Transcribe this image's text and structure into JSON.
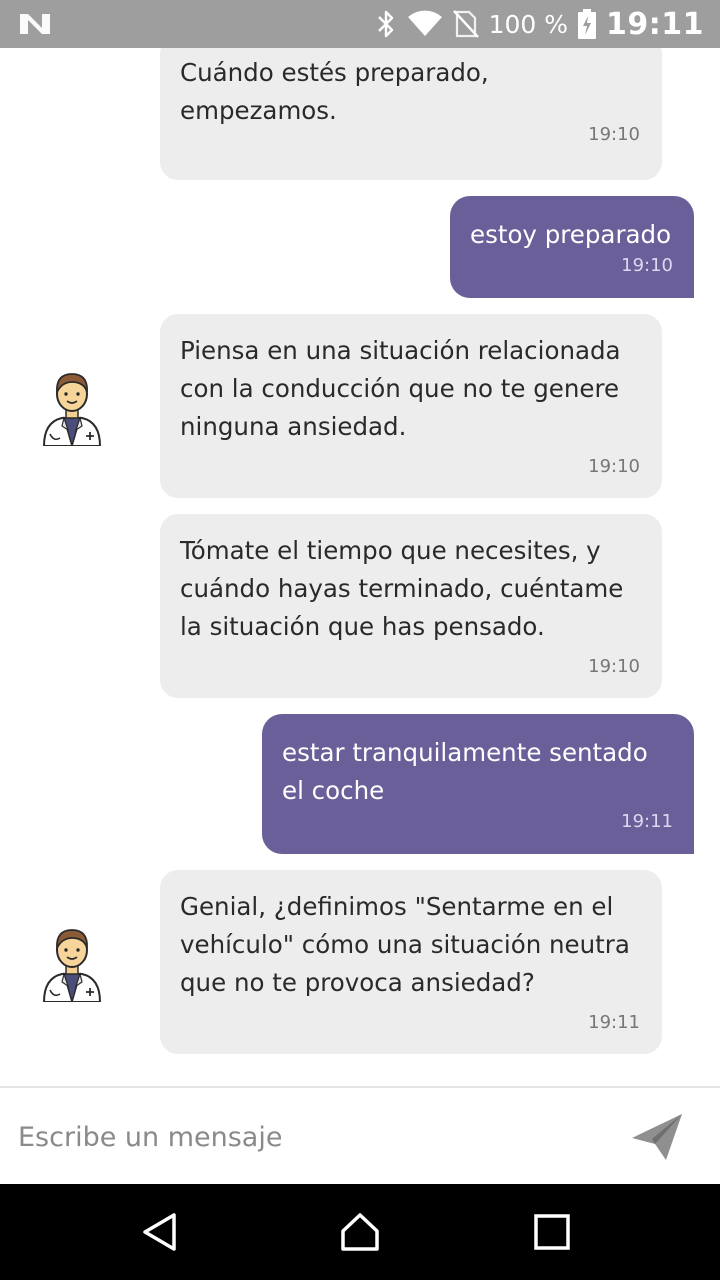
{
  "status_bar": {
    "battery": "100 %",
    "time": "19:11",
    "icons": [
      "notification-n-icon",
      "bluetooth-icon",
      "wifi-icon",
      "no-sim-icon",
      "battery-charging-icon"
    ]
  },
  "messages": [
    {
      "sender": "bot",
      "text": "Cuándo estés preparado,\nempezamos.",
      "time": "19:10"
    },
    {
      "sender": "user",
      "text": "estoy preparado",
      "time": "19:10"
    },
    {
      "sender": "bot",
      "text": "Piensa en una situación relacionada\ncon la conducción que no te genere\nninguna ansiedad.",
      "time": "19:10"
    },
    {
      "sender": "bot",
      "text": "Tómate el tiempo que necesites, y\ncuándo hayas terminado, cuéntame\nla situación que has pensado.",
      "time": "19:10"
    },
    {
      "sender": "user",
      "text": "estar tranquilamente sentado\nel coche",
      "time": "19:11"
    },
    {
      "sender": "bot",
      "text": "Genial, ¿definimos \"Sentarme en el\nvehículo\" cómo una situación neutra\nque no te provoca ansiedad?",
      "time": "19:11"
    }
  ],
  "composer": {
    "placeholder": "Escribe un mensaje",
    "send_icon": "send-icon"
  },
  "nav_bar": {
    "icons": [
      "back-icon",
      "home-icon",
      "recents-icon"
    ]
  },
  "colors": {
    "user_bubble": "#6a5f99",
    "bot_bubble": "#ededed",
    "status_bar": "#9e9e9e"
  }
}
